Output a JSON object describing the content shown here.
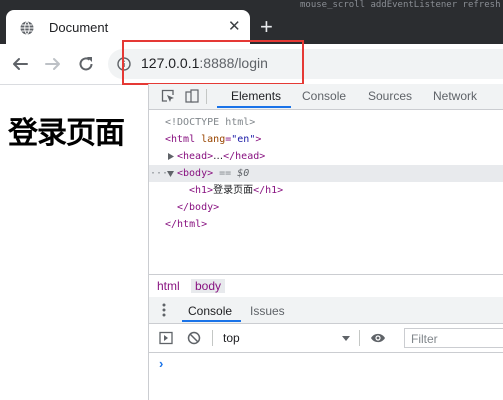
{
  "browser": {
    "background_strip": "mouse_scroll  addEventListener  refresh  callback  onclick",
    "tab": {
      "title": "Document",
      "close": "✕"
    },
    "new_tab": "+",
    "url_host": "127.0.0.1",
    "url_rest": ":8888/login",
    "icons": [
      "back-arrow-icon",
      "forward-arrow-icon",
      "reload-icon",
      "info-icon",
      "globe-icon"
    ]
  },
  "page": {
    "heading": "登录页面"
  },
  "devtools": {
    "tabs": [
      "Elements",
      "Console",
      "Sources",
      "Network"
    ],
    "active_tab": "Elements",
    "dom": {
      "doctype": "<!DOCTYPE html>",
      "html_open_tag": "<html",
      "lang_attr": "lang",
      "lang_value": "\"en\"",
      "gt": ">",
      "head_open": "<head>",
      "ellipsis": "…",
      "head_close": "</head>",
      "body_open": "<body>",
      "dots": "···",
      "eq": " == ",
      "dollar": "$0",
      "h1_open": "<h1>",
      "h1_text": "登录页面",
      "h1_close": "</h1>",
      "body_close": "</body>",
      "html_close": "</html>"
    },
    "breadcrumbs": [
      "html",
      "body"
    ],
    "drawer": {
      "tabs": [
        "Console",
        "Issues"
      ],
      "active_tab": "Console",
      "context": "top",
      "filter_placeholder": "Filter",
      "prompt": "›"
    }
  },
  "colors": {
    "annotation": "#e53935",
    "active_tab_underline": "#1a73e8",
    "tag": "#881280"
  }
}
